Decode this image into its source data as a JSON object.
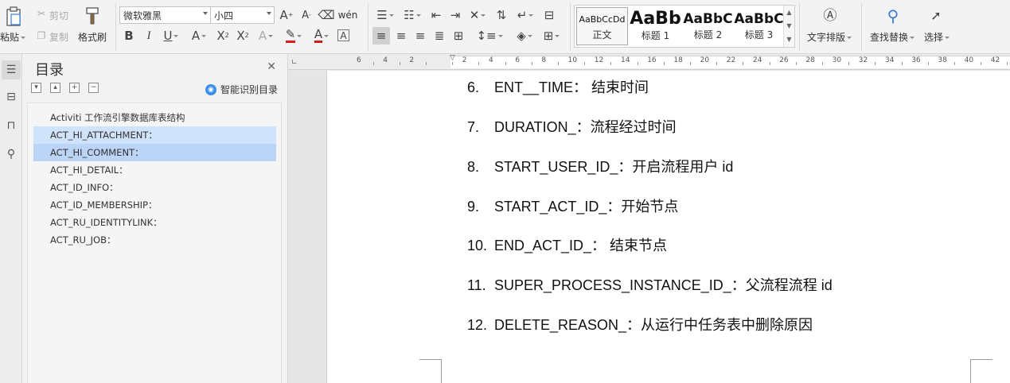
{
  "ribbon": {
    "clipboard": {
      "paste_label": "粘贴",
      "cut_label": "剪切",
      "copy_label": "复制",
      "format_painter_label": "格式刷"
    },
    "font": {
      "family_value": "微软雅黑",
      "size_value": "小四"
    },
    "styles": {
      "items": [
        {
          "preview": "AaBbCcDd",
          "label": "正文"
        },
        {
          "preview": "AaBb",
          "label": "标题 1"
        },
        {
          "preview": "AaBbC",
          "label": "标题 2"
        },
        {
          "preview": "AaBbC",
          "label": "标题 3"
        }
      ]
    },
    "text_layout_label": "文字排版",
    "find_replace_label": "查找替换",
    "select_label": "选择"
  },
  "toc": {
    "title": "目录",
    "smart_label": "智能识别目录",
    "items": [
      "Activiti 工作流引擎数据库表结构",
      "ACT_HI_ATTACHMENT：",
      "ACT_HI_COMMENT：",
      "ACT_HI_DETAIL：",
      "ACT_ID_INFO：",
      "ACT_ID_MEMBERSHIP：",
      "ACT_RU_IDENTITYLINK：",
      "ACT_RU_JOB："
    ]
  },
  "ruler": {
    "labels": [
      "6",
      "4",
      "2",
      "",
      "2",
      "4",
      "6",
      "8",
      "10",
      "12",
      "14",
      "16",
      "18",
      "20",
      "22",
      "24",
      "26",
      "28",
      "30",
      "32",
      "34",
      "36",
      "38",
      "40",
      "42"
    ]
  },
  "document": {
    "lines": [
      {
        "num": "6.",
        "text": "ENT__TIME： 结束时间"
      },
      {
        "num": "7.",
        "text": "DURATION_：流程经过时间"
      },
      {
        "num": "8.",
        "text": "START_USER_ID_：开启流程用户 id"
      },
      {
        "num": "9.",
        "text": "START_ACT_ID_：开始节点"
      },
      {
        "num": "10.",
        "text": "END_ACT_ID_： 结束节点"
      },
      {
        "num": "11.",
        "text": "SUPER_PROCESS_INSTANCE_ID_：父流程流程 id"
      },
      {
        "num": "12.",
        "text": "DELETE_REASON_：从运行中任务表中删除原因"
      }
    ]
  },
  "colors": {
    "accent": "#3c8ee8",
    "font_color_bar": "#d01b1b",
    "highlight_bar": "#e31b1b",
    "toc_selected": "#bcd4f6"
  }
}
